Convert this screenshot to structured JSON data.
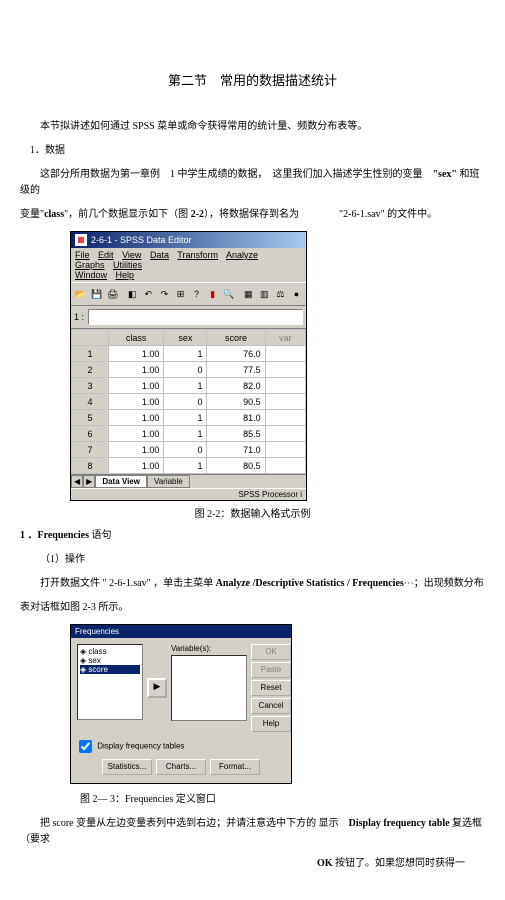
{
  "title": "第二节　常用的数据描述统计",
  "p1": "本节拟讲述如何通过 SPSS 菜单或命令获得常用的统计量、频数分布表等。",
  "p2": "1．数据",
  "p3a": "这部分所用数据为第一章例　1 中学生成绩的数据，　这里我们加入描述学生性别的变量　",
  "p3b": "\"sex\"",
  "p3c": " 和班级的",
  "p4a": "变量\"",
  "p4b": "class",
  "p4c": "\"，前几个数据显示如下（图",
  "p4d": " 2-2",
  "p4e": "），将数据保存到名为　　　　\"2-6-1.sav\" 的文件中。",
  "win1": {
    "title": "2-6-1 - SPSS Data Editor",
    "menus": [
      "File",
      "Edit",
      "View",
      "Data",
      "Transform",
      "Analyze",
      "Graphs",
      "Utilities",
      "Window",
      "Help"
    ],
    "rowlabel": "1 :",
    "cols": [
      "class",
      "sex",
      "score",
      "var"
    ],
    "rows": [
      [
        "1",
        "1.00",
        "1",
        "76.0",
        ""
      ],
      [
        "2",
        "1.00",
        "0",
        "77.5",
        ""
      ],
      [
        "3",
        "1.00",
        "1",
        "82.0",
        ""
      ],
      [
        "4",
        "1.00",
        "0",
        "90.5",
        ""
      ],
      [
        "5",
        "1.00",
        "1",
        "81.0",
        ""
      ],
      [
        "6",
        "1.00",
        "1",
        "85.5",
        ""
      ],
      [
        "7",
        "1.00",
        "0",
        "71.0",
        ""
      ],
      [
        "8",
        "1.00",
        "1",
        "80.5",
        ""
      ]
    ],
    "tab1": "Data View",
    "tab2": "Variable",
    "status": "SPSS Processor i"
  },
  "cap1": "图 2-2：数据输入格式示例",
  "h1a": "1 ．",
  "h1b": "Frequencies",
  "h1c": " 语句",
  "p5": "（1）操作",
  "p6a": "打开数据文件 \" 2-6-1.sav\" ，单击主菜单 ",
  "p6b": "Analyze /Descriptive Statistics / Frequencies",
  "p6c": "⋯；出现频数分布",
  "p7": "表对话框如图 2-3 所示。",
  "win2": {
    "title": "Frequencies",
    "left": [
      "class",
      "sex",
      "score"
    ],
    "varlabel": "Variable(s):",
    "btns": [
      "OK",
      "Paste",
      "Reset",
      "Cancel",
      "Help"
    ],
    "chk": "Display frequency tables",
    "bbtns": [
      "Statistics...",
      "Charts...",
      "Format..."
    ]
  },
  "cap2a": "图 2— 3：",
  "cap2b": "Frequencies",
  "cap2c": " 定义窗口",
  "p8a": "把 score 变量从左边变量表列中选到右边；并请注意选中下方的 显示　",
  "p8b": "Display frequency table",
  "p8c": " 复选框（要求",
  "p9a": "OK",
  "p9b": " 按钮了。如果您想同时获得一"
}
